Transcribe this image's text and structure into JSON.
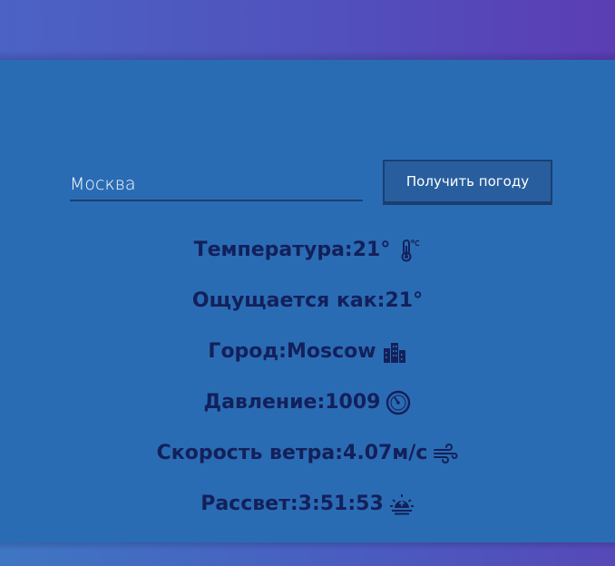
{
  "search": {
    "city_value": "Москва",
    "button_label": "Получить погоду"
  },
  "weather": {
    "temperature": "Температура:21°",
    "feels_like": "Ощущается как:21°",
    "city": "Город:Moscow",
    "pressure": "Давление:1009",
    "wind_speed": "Скорость ветра:4.07м/с",
    "sunrise": "Рассвет:3:51:53",
    "icons": {
      "temperature": "thermometer-celsius-icon",
      "city": "city-buildings-icon",
      "pressure": "barometer-icon",
      "wind_speed": "wind-icon",
      "sunrise": "sunrise-icon"
    }
  },
  "colors": {
    "main_background": "#2a6cb4",
    "text": "#13205a",
    "button_background": "#285e9e"
  }
}
